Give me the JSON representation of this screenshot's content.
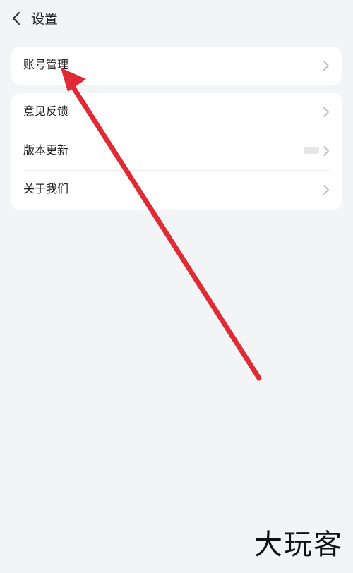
{
  "header": {
    "title": "设置",
    "back_icon": "chevron-left-icon"
  },
  "groups": [
    {
      "items": [
        {
          "label": "账号管理",
          "icon": "chevron-right-icon"
        }
      ]
    },
    {
      "items": [
        {
          "label": "意见反馈",
          "icon": "chevron-right-icon"
        },
        {
          "label": "版本更新",
          "icon": "chevron-right-icon"
        },
        {
          "label": "关于我们",
          "icon": "chevron-right-icon"
        }
      ]
    }
  ],
  "annotation": {
    "arrow_color": "#e02b35"
  },
  "watermark": {
    "text": "大玩客"
  },
  "colors": {
    "background": "#f3f4f6",
    "card": "#ffffff",
    "chevron": "#b8b8b8"
  }
}
